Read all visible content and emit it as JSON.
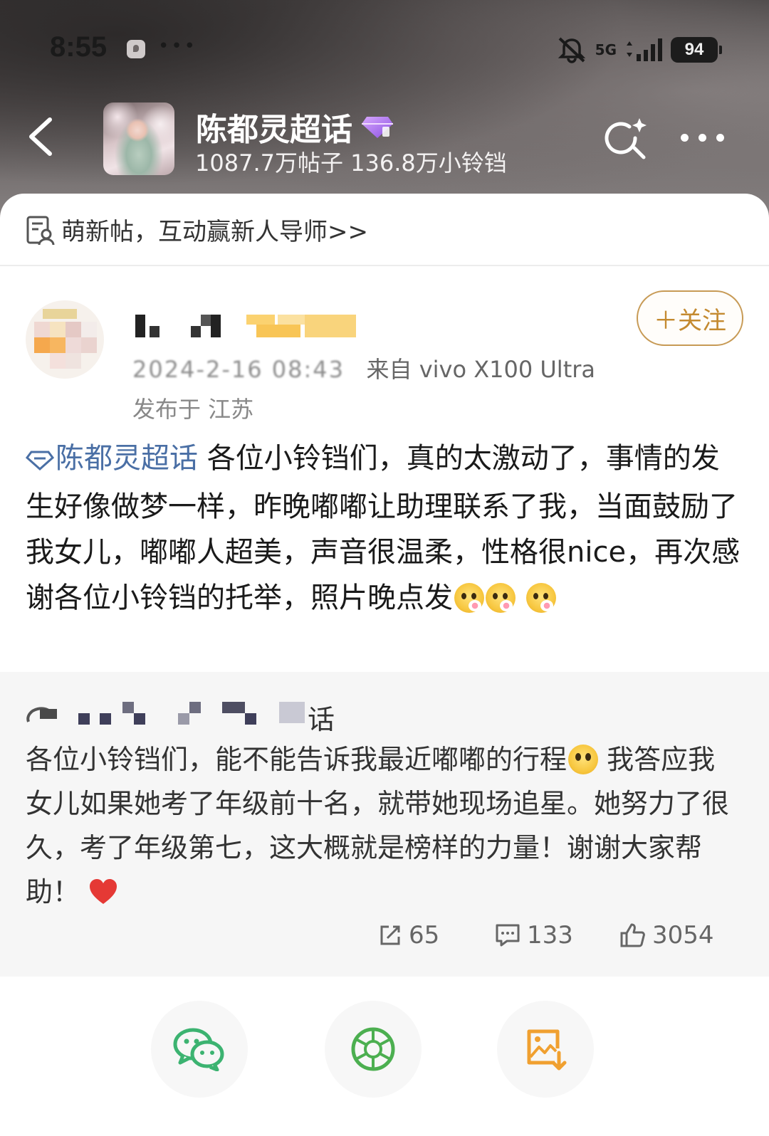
{
  "status_bar": {
    "time": "8:55",
    "network": "5G",
    "battery": "94"
  },
  "topic": {
    "back_icon": "chevron-left-icon",
    "title": "陈都灵超话",
    "stats": "1087.7万帖子 136.8万小铃铛",
    "search_icon": "search-spark-icon",
    "more_icon": "more-icon"
  },
  "notice": {
    "text": "萌新帖，互动赢新人导师>>"
  },
  "post": {
    "follow_label": "＋关注",
    "time_masked": "2024-2-16 08:43",
    "source": "来自 vivo X100 Ultra",
    "location": "发布于 江苏",
    "topic_tag": "陈都灵超话",
    "text": "各位小铃铛们，真的太激动了，事情的发生好像做梦一样，昨晚嘟嘟让助理联系了我，当面鼓励了我女儿，嘟嘟人超美，声音很温柔，性格很nice，再次感谢各位小铃铛的托举，照片晚点发"
  },
  "quote": {
    "source_tail": "话",
    "text_1": "各位小铃铛们，能不能告诉我最近嘟嘟的行程",
    "text_2": " 我答应我女儿如果她考了年级前十名，就带她现场追星。她努力了很久，考了年级第七，这大概就是榜样的力量！谢谢大家帮助！"
  },
  "actions": {
    "repost": "65",
    "comment": "133",
    "like": "3054"
  },
  "share": [
    {
      "name": "wechat-icon",
      "color": "#3cb371"
    },
    {
      "name": "moments-icon",
      "color": "#4caf50"
    },
    {
      "name": "save-image-icon",
      "color": "#f0a030"
    }
  ],
  "colors": {
    "accent_gold": "#c48a30",
    "topic_blue": "#4a6fa5",
    "heart_red": "#e53935"
  }
}
